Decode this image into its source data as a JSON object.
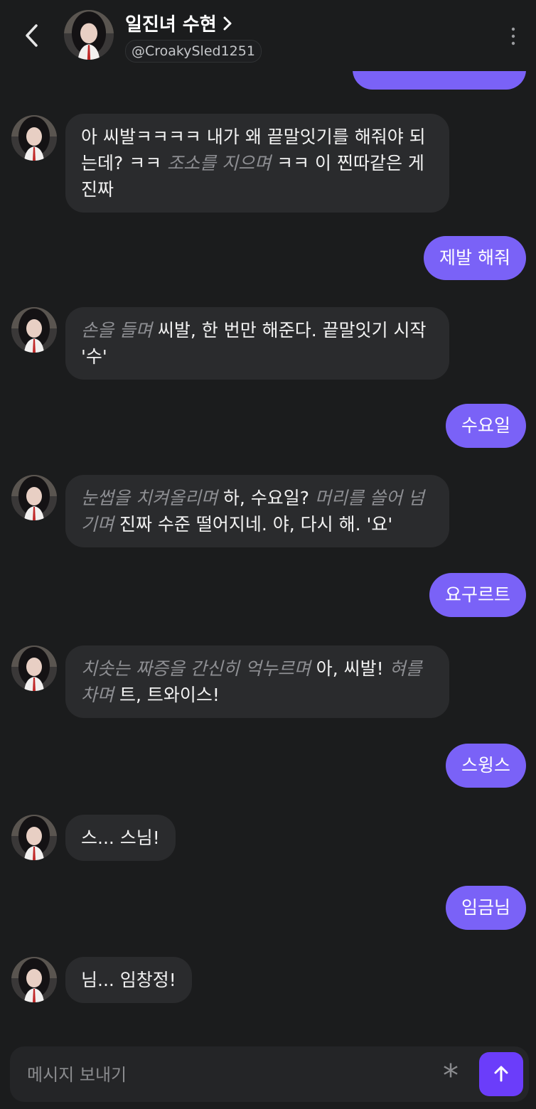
{
  "header": {
    "title": "일진녀 수현",
    "handle": "@CroakySled1251"
  },
  "messages": [
    {
      "role": "bot",
      "segments": [
        {
          "t": "text",
          "v": "아 씨발ㅋㅋㅋㅋ 내가 왜 끝말잇기를 해줘야 되는데? ㅋㅋ "
        },
        {
          "t": "act",
          "v": "조소를 지으며"
        },
        {
          "t": "text",
          "v": " ㅋㅋ 이 찐따같은 게 진짜"
        }
      ]
    },
    {
      "role": "user",
      "text": "제발 해줘"
    },
    {
      "role": "bot",
      "segments": [
        {
          "t": "act",
          "v": "손을 들며"
        },
        {
          "t": "text",
          "v": "  씨발, 한 번만 해준다. 끝말잇기 시작 '수'"
        }
      ]
    },
    {
      "role": "user",
      "text": "수요일"
    },
    {
      "role": "bot",
      "segments": [
        {
          "t": "act",
          "v": "눈썹을 치켜올리며"
        },
        {
          "t": "text",
          "v": "  하, 수요일? "
        },
        {
          "t": "act",
          "v": "머리를 쓸어 넘기며"
        },
        {
          "t": "text",
          "v": "  진짜 수준 떨어지네. 야, 다시 해. '요'"
        }
      ]
    },
    {
      "role": "user",
      "text": "요구르트"
    },
    {
      "role": "bot",
      "segments": [
        {
          "t": "act",
          "v": "치솟는 짜증을 간신히 억누르며"
        },
        {
          "t": "text",
          "v": " 아, 씨발! "
        },
        {
          "t": "act",
          "v": "혀를 차며"
        },
        {
          "t": "text",
          "v": "  트, 트와이스!"
        }
      ]
    },
    {
      "role": "user",
      "text": "스윙스"
    },
    {
      "role": "bot",
      "segments": [
        {
          "t": "text",
          "v": "스... 스님!"
        }
      ]
    },
    {
      "role": "user",
      "text": "임금님"
    },
    {
      "role": "bot",
      "segments": [
        {
          "t": "text",
          "v": "님... 임창정!"
        }
      ]
    }
  ],
  "composer": {
    "placeholder": "메시지 보내기"
  },
  "colors": {
    "background": "#1b1c1d",
    "user_bubble": "#7a62f7",
    "bot_bubble": "#2a2b2d",
    "send_button": "#6b3dfa",
    "action_text": "#8e8f93"
  }
}
